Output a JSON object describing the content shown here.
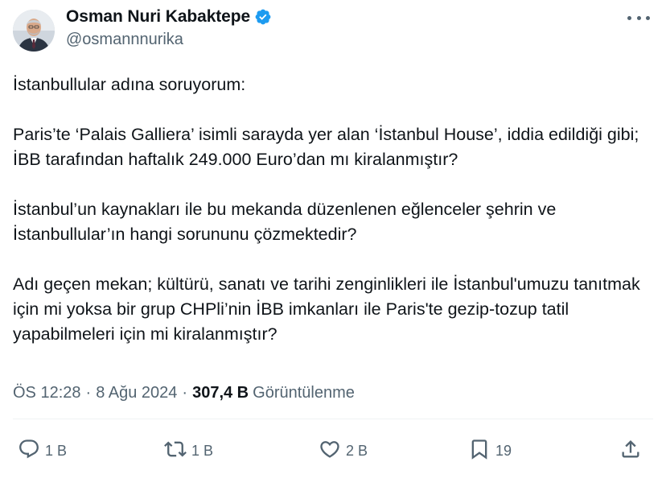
{
  "author": {
    "display_name": "Osman Nuri Kabaktepe",
    "handle": "@osmannnurika",
    "verified": true
  },
  "tweet": {
    "paragraphs": [
      "İstanbullular adına soruyorum:",
      "Paris’te ‘Palais Galliera’ isimli sarayda yer alan ‘İstanbul House’, iddia edildiği gibi; İBB tarafından haftalık 249.000 Euro’dan mı kiralanmıştır?",
      "İstanbul’un kaynakları ile bu mekanda düzenlenen eğlenceler şehrin ve İstanbullular’ın hangi sorununu çözmektedir?",
      "Adı geçen mekan; kültürü, sanatı ve tarihi zenginlikleri ile İstanbul'umuzu tanıtmak için mi yoksa bir grup CHPli’nin İBB imkanları ile Paris'te gezip-tozup tatil yapabilmeleri için mi kiralanmıştır?"
    ],
    "time": "ÖS 12:28",
    "separator": "·",
    "date": "8 Ağu 2024",
    "views_count": "307,4 B",
    "views_label": "Görüntülenme"
  },
  "actions": {
    "reply_count": "1 B",
    "retweet_count": "1 B",
    "like_count": "2 B",
    "bookmark_count": "19"
  },
  "icons": {
    "verified": "verified-badge-icon",
    "more": "more-icon",
    "reply": "reply-icon",
    "retweet": "retweet-icon",
    "like": "heart-icon",
    "bookmark": "bookmark-icon",
    "share": "share-icon"
  },
  "colors": {
    "verified_blue": "#1d9bf0",
    "text_primary": "#0f1419",
    "text_secondary": "#536471"
  }
}
